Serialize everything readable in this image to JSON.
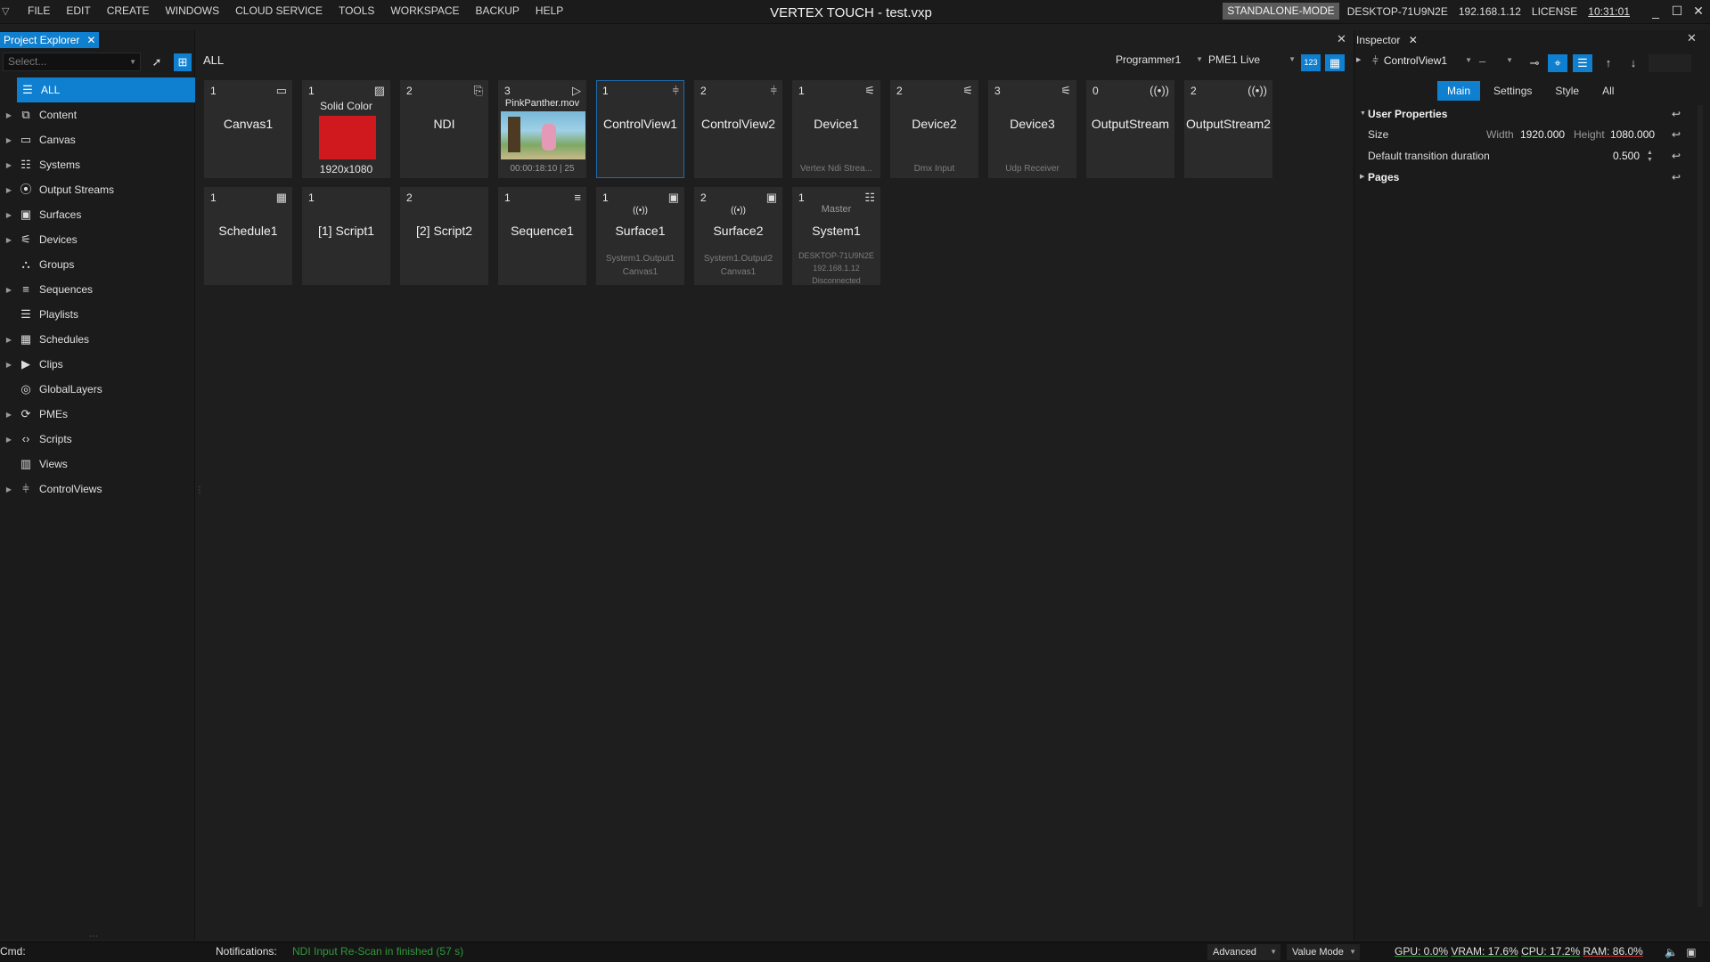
{
  "menu": {
    "items": [
      "FILE",
      "EDIT",
      "CREATE",
      "WINDOWS",
      "CLOUD SERVICE",
      "TOOLS",
      "WORKSPACE",
      "BACKUP",
      "HELP"
    ]
  },
  "app_title": "VERTEX TOUCH - test.vxp",
  "status": {
    "mode": "STANDALONE-MODE",
    "host": "DESKTOP-71U9N2E",
    "ip": "192.168.1.12",
    "license": "LICENSE",
    "time": "10:31:01"
  },
  "project_explorer": {
    "tab_label": "Project Explorer",
    "search_placeholder": "Select...",
    "tree": [
      {
        "label": "ALL",
        "icon": "list-icon",
        "expandable": false,
        "selected": true
      },
      {
        "label": "Content",
        "icon": "content-icon",
        "expandable": true
      },
      {
        "label": "Canvas",
        "icon": "canvas-icon",
        "expandable": true
      },
      {
        "label": "Systems",
        "icon": "server-icon",
        "expandable": true
      },
      {
        "label": "Output Streams",
        "icon": "broadcast-icon",
        "expandable": true
      },
      {
        "label": "Surfaces",
        "icon": "surface-icon",
        "expandable": true
      },
      {
        "label": "Devices",
        "icon": "plug-icon",
        "expandable": true
      },
      {
        "label": "Groups",
        "icon": "groups-icon",
        "expandable": false
      },
      {
        "label": "Sequences",
        "icon": "sequence-icon",
        "expandable": true
      },
      {
        "label": "Playlists",
        "icon": "playlist-icon",
        "expandable": false
      },
      {
        "label": "Schedules",
        "icon": "calendar-icon",
        "expandable": true
      },
      {
        "label": "Clips",
        "icon": "clip-icon",
        "expandable": true
      },
      {
        "label": "GlobalLayers",
        "icon": "globe-icon",
        "expandable": false
      },
      {
        "label": "PMEs",
        "icon": "pme-icon",
        "expandable": true
      },
      {
        "label": "Scripts",
        "icon": "code-icon",
        "expandable": true
      },
      {
        "label": "Views",
        "icon": "views-icon",
        "expandable": false
      },
      {
        "label": "ControlViews",
        "icon": "sliders-icon",
        "expandable": true
      }
    ]
  },
  "center": {
    "breadcrumb": "ALL",
    "programmer": "Programmer1",
    "pme": "PME1 Live",
    "btn_123": "123",
    "tiles_row1": [
      {
        "num": "1",
        "icon": "canvas-icon",
        "name": "Canvas1"
      },
      {
        "num": "1",
        "icon": "image-icon",
        "top": "Solid Color",
        "bottom": "1920x1080",
        "kind": "swatch"
      },
      {
        "num": "2",
        "icon": "ndi-icon",
        "name": "NDI"
      },
      {
        "num": "3",
        "icon": "play-icon",
        "top": "PinkPanther.mov",
        "bottom": "00:00:18:10 | 25",
        "kind": "thumb"
      },
      {
        "num": "1",
        "icon": "sliders-icon",
        "name": "ControlView1",
        "selected": true
      },
      {
        "num": "2",
        "icon": "sliders-icon",
        "name": "ControlView2"
      },
      {
        "num": "1",
        "icon": "plug-icon",
        "name": "Device1",
        "sub": "Vertex Ndi Strea..."
      },
      {
        "num": "2",
        "icon": "plug-icon",
        "name": "Device2",
        "sub": "Dmx Input"
      },
      {
        "num": "3",
        "icon": "plug-icon",
        "name": "Device3",
        "sub": "Udp Receiver"
      },
      {
        "num": "0",
        "icon": "broadcast-icon",
        "name": "OutputStream"
      },
      {
        "num": "2",
        "icon": "broadcast-icon",
        "name": "OutputStream2"
      }
    ],
    "tiles_row2": [
      {
        "num": "1",
        "icon": "calendar-icon",
        "name": "Schedule1"
      },
      {
        "num": "1",
        "icon": "code-icon",
        "name": "[1] Script1"
      },
      {
        "num": "2",
        "icon": "code-icon",
        "name": "[2] Script2"
      },
      {
        "num": "1",
        "icon": "sequence-icon",
        "name": "Sequence1"
      },
      {
        "num": "1",
        "icon": "surface-icon",
        "name": "Surface1",
        "sub": "System1.Output1",
        "sub2": "Canvas1",
        "top_icon": "broadcast-icon"
      },
      {
        "num": "2",
        "icon": "surface-icon",
        "name": "Surface2",
        "sub": "System1.Output2",
        "sub2": "Canvas1",
        "top_icon": "broadcast-icon"
      },
      {
        "num": "1",
        "icon": "server-icon",
        "name": "System1",
        "top": "Master",
        "sub": "DESKTOP-71U9N2E",
        "sub2": "192.168.1.12",
        "sub3": "Disconnected"
      }
    ]
  },
  "inspector": {
    "tab_label": "Inspector",
    "selected": "ControlView1",
    "dash": "–",
    "tabs": [
      "Main",
      "Settings",
      "Style",
      "All"
    ],
    "active_tab": "Main",
    "user_properties": "User Properties",
    "size_label": "Size",
    "width_label": "Width",
    "width_value": "1920.000",
    "height_label": "Height",
    "height_value": "1080.000",
    "transition_label": "Default transition duration",
    "transition_value": "0.500",
    "pages_label": "Pages"
  },
  "statusbar": {
    "cmd": "Cmd:",
    "notifications_label": "Notifications:",
    "notification": "NDI Input Re-Scan in finished (57 s)",
    "advanced": "Advanced",
    "value_mode": "Value Mode",
    "gpu": "GPU: 0.0%",
    "vram": "VRAM: 17.6%",
    "cpu": "CPU: 17.2%",
    "ram": "RAM: 86.0%"
  },
  "colors": {
    "accent": "#0f7fd0",
    "swatch": "#d0191f",
    "notif": "#2f9a3a"
  }
}
